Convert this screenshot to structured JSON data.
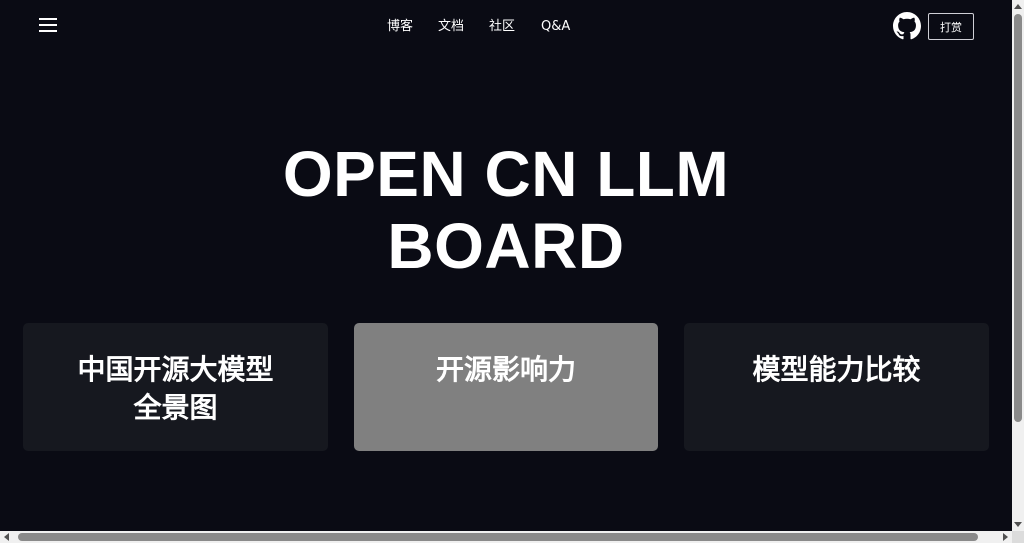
{
  "header": {
    "menu_icon": "hamburger-menu-icon",
    "nav": [
      {
        "label": "博客"
      },
      {
        "label": "文档"
      },
      {
        "label": "社区"
      },
      {
        "label": "Q&A"
      }
    ],
    "github_icon": "github-icon",
    "donate_label": "打赏"
  },
  "hero": {
    "title_line1": "OPEN CN LLM",
    "title_line2": "BOARD"
  },
  "cards": [
    {
      "line1": "中国开源大模型",
      "line2": "全景图",
      "color": "#16181f"
    },
    {
      "line1": "开源影响力",
      "line2": "",
      "color": "#808080"
    },
    {
      "line1": "模型能力比较",
      "line2": "",
      "color": "#16181f"
    }
  ],
  "colors": {
    "background": "#0a0b14",
    "card": "#16181f",
    "card_active": "#808080",
    "text": "#ffffff"
  }
}
